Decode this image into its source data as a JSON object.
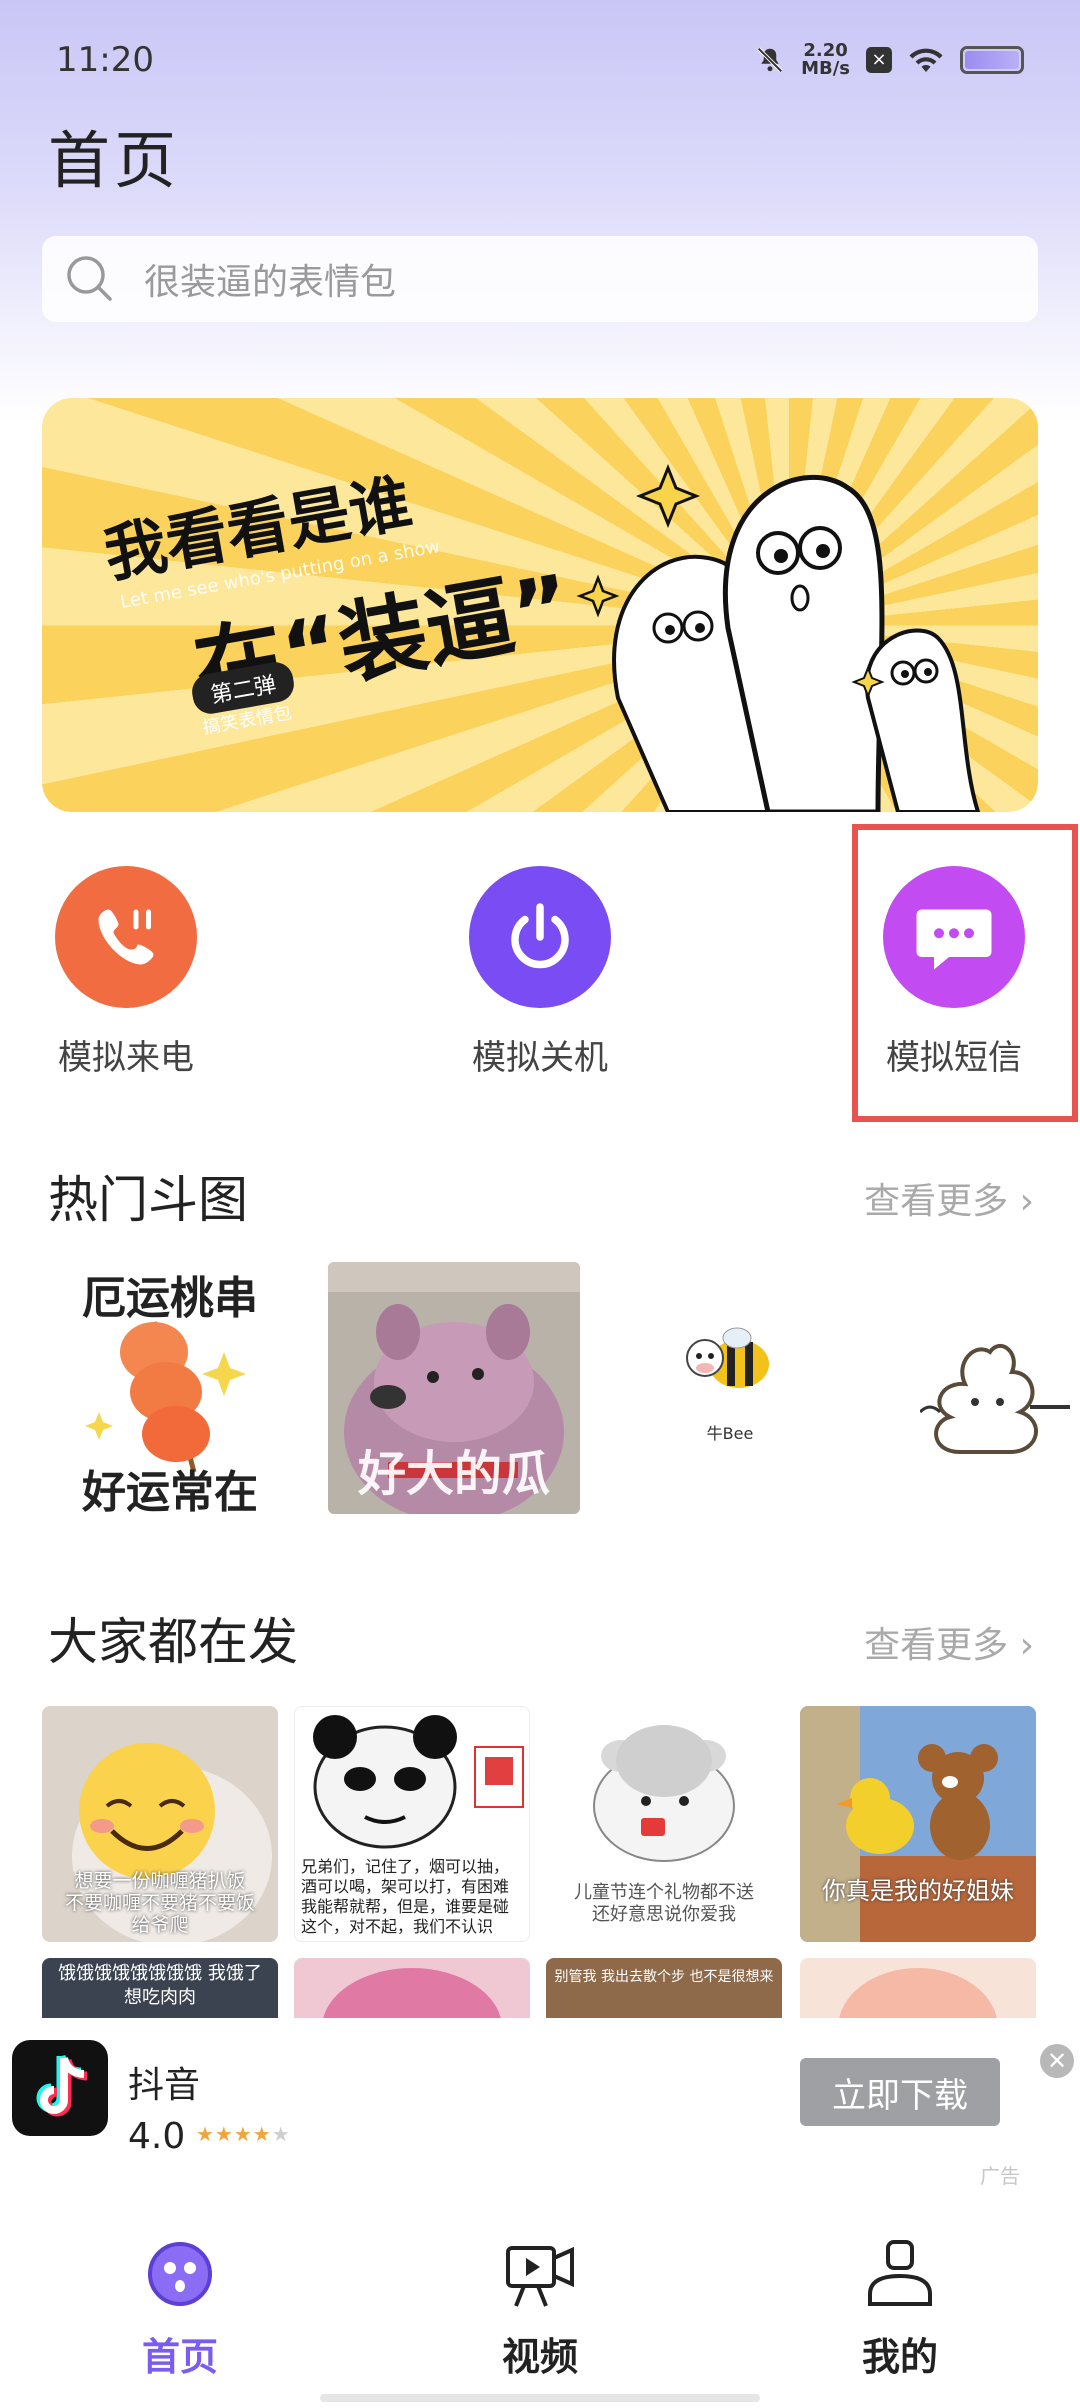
{
  "status_bar": {
    "time": "11:20",
    "speed_value": "2.20",
    "speed_unit": "MB/s"
  },
  "page_title": "首页",
  "search": {
    "placeholder": "很装逼的表情包"
  },
  "banner": {
    "line1": "我看看是谁",
    "line2": "在“装逼”",
    "subtitle": "Let me see who's putting on a show",
    "tag": "第二弹",
    "tag_sub": "搞笑表情包"
  },
  "quick_actions": [
    {
      "label": "模拟来电",
      "color": "#f26c42",
      "icon": "phone-icon"
    },
    {
      "label": "模拟关机",
      "color": "#7a4cf3",
      "icon": "power-icon"
    },
    {
      "label": "模拟短信",
      "color": "#c24cf1",
      "icon": "message-icon"
    }
  ],
  "sections": {
    "hot": {
      "title": "热门斗图",
      "more": "查看更多 ›"
    },
    "everyone": {
      "title": "大家都在发",
      "more": "查看更多 ›"
    }
  },
  "hot_cards": [
    {
      "top": "厄运桃串",
      "bottom": "好运常在"
    },
    {
      "caption": "好大的瓜"
    },
    {
      "caption": "牛Bee"
    }
  ],
  "everyone_cards": [
    {
      "caption": "想要一份咖喱猪扒饭\n不要咖喱不要猪不要饭\n给爷爬"
    },
    {
      "caption": "兄弟们，记住了，烟可以抽，酒可以喝，架可以打，有困难我能帮就帮，但是，谁要是碰这个，对不起，我们不认识"
    },
    {
      "caption": "儿童节连个礼物都不送\n还好意思说你爱我"
    },
    {
      "caption": "你真是我的好姐妹"
    }
  ],
  "everyone_row2": [
    {
      "caption": "饿饿饿饿饿饿饿饿 我饿了 想吃肉肉"
    },
    {
      "caption": ""
    },
    {
      "caption": "别管我 我出去散个步 也不是很想来"
    },
    {
      "caption": ""
    }
  ],
  "ad": {
    "app_name": "抖音",
    "rating": "4.0",
    "button": "立即下载",
    "close": "✕",
    "label": "广告"
  },
  "bottom_nav": [
    {
      "label": "首页",
      "icon": "home-face-icon",
      "active": true
    },
    {
      "label": "视频",
      "icon": "video-camera-icon",
      "active": false
    },
    {
      "label": "我的",
      "icon": "profile-icon",
      "active": false
    }
  ]
}
